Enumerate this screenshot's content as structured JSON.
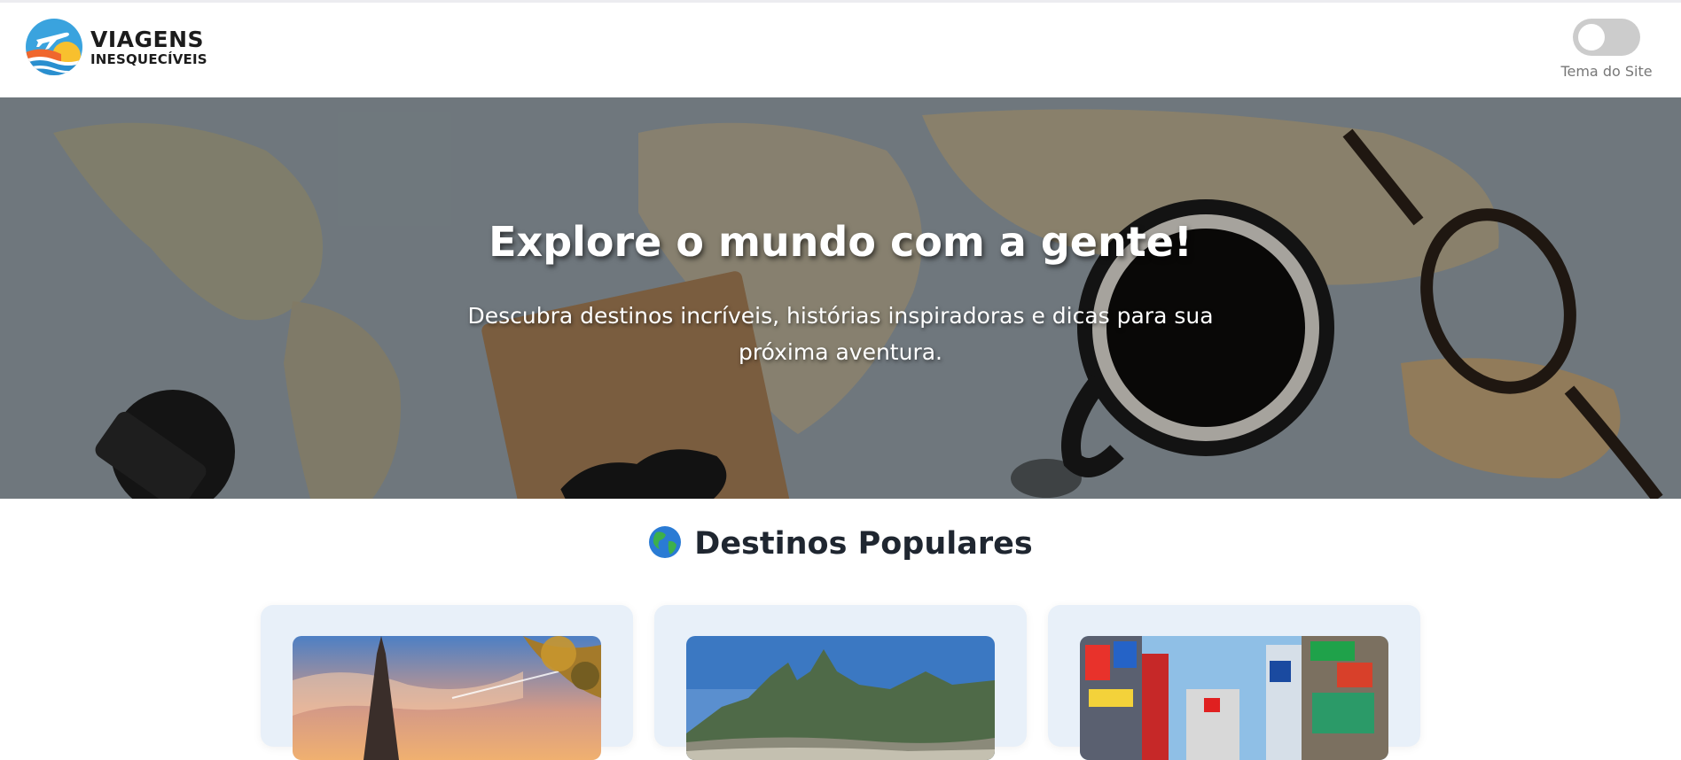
{
  "brand": {
    "line1": "VIAGENS",
    "line2": "INESQUECÍVEIS",
    "logo_icon": "plane-sun-logo"
  },
  "theme": {
    "label": "Tema do Site",
    "enabled": false
  },
  "hero": {
    "title": "Explore o mundo com a gente!",
    "subtitle": "Descubra destinos incríveis, histórias inspiradoras e dicas para sua próxima aventura."
  },
  "destinations": {
    "title": "Destinos Populares",
    "title_icon": "globe-icon",
    "cards": [
      {
        "image": "paris-eiffel-tower"
      },
      {
        "image": "rio-de-janeiro-mountains"
      },
      {
        "image": "tokyo-city-street"
      }
    ]
  },
  "colors": {
    "card_background": "#e8f0f9",
    "toggle_off": "#cccccc"
  }
}
